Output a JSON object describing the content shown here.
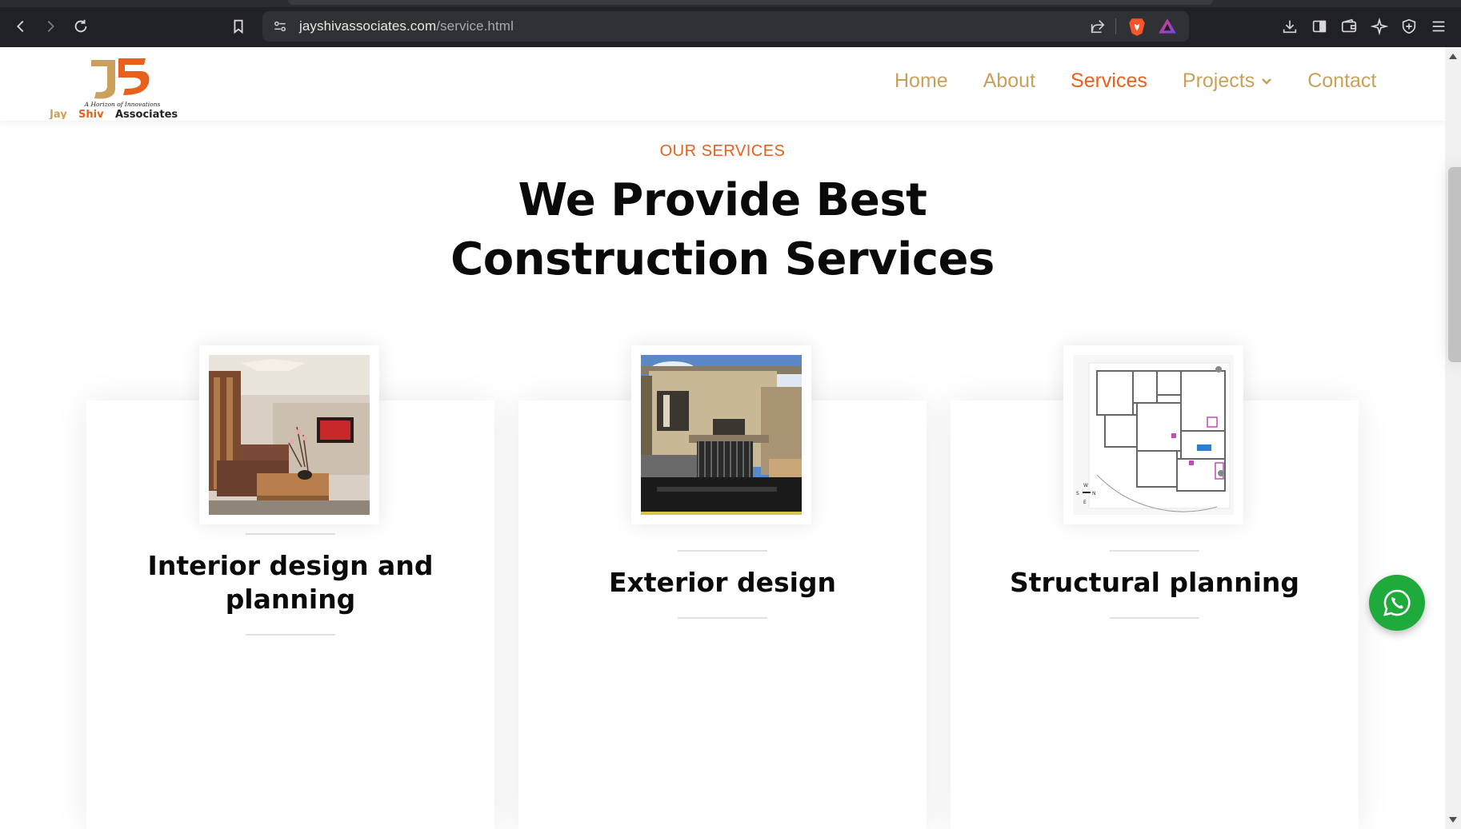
{
  "browser": {
    "url_domain": "jayshivassociates.com",
    "url_path": "/service.html",
    "icons": [
      "back-icon",
      "forward-icon",
      "reload-icon",
      "bookmark-icon",
      "site-settings-icon",
      "share-icon",
      "brave-shields-icon",
      "brave-rewards-icon",
      "download-icon",
      "sidebar-icon",
      "wallet-icon",
      "leo-ai-icon",
      "vpn-icon",
      "menu-icon"
    ]
  },
  "header": {
    "logo_tagline": "A Horizon of Innovations",
    "logo_brand_a": "Jay",
    "logo_brand_b": "Shiv",
    "logo_brand_c": "Associates",
    "nav": {
      "home": "Home",
      "about": "About",
      "services": "Services",
      "projects": "Projects",
      "contact": "Contact"
    }
  },
  "services": {
    "eyebrow": "OUR SERVICES",
    "headline_line1": "We Provide Best",
    "headline_line2": "Construction Services",
    "cards": [
      {
        "title": "Interior design and planning",
        "image": "interior-living-room"
      },
      {
        "title": "Exterior design",
        "image": "house-exterior"
      },
      {
        "title": "Structural planning",
        "image": "floor-plan"
      }
    ]
  },
  "colors": {
    "accent": "#e8601c",
    "nav_gold": "#caa15a",
    "whatsapp": "#1faa3c"
  }
}
